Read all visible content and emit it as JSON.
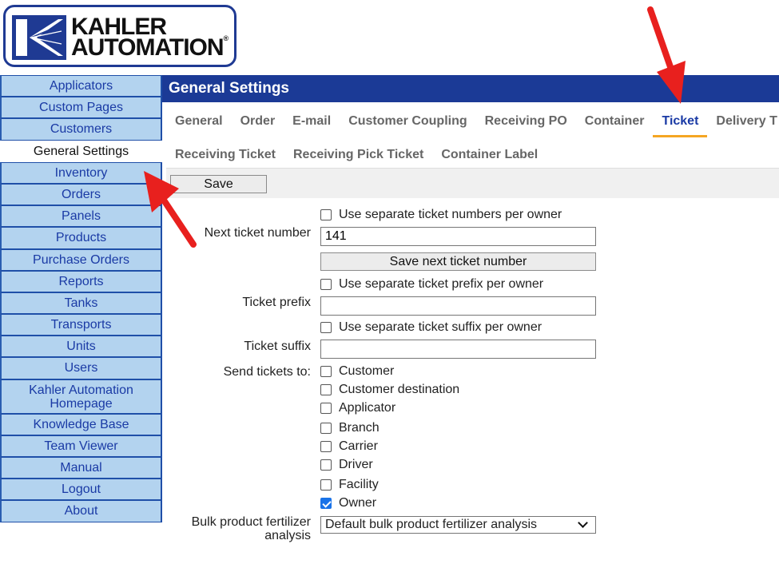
{
  "logo": {
    "line1": "KAHLER",
    "line2": "AUTOMATION",
    "reg": "®"
  },
  "sidebar": {
    "items": [
      {
        "label": "Applicators"
      },
      {
        "label": "Custom Pages"
      },
      {
        "label": "Customers"
      },
      {
        "label": "General Settings",
        "active": true
      },
      {
        "label": "Inventory"
      },
      {
        "label": "Orders"
      },
      {
        "label": "Panels"
      },
      {
        "label": "Products"
      },
      {
        "label": "Purchase Orders"
      },
      {
        "label": "Reports"
      },
      {
        "label": "Tanks"
      },
      {
        "label": "Transports"
      },
      {
        "label": "Units"
      },
      {
        "label": "Users"
      },
      {
        "label": "Kahler Automation Homepage"
      },
      {
        "label": "Knowledge Base"
      },
      {
        "label": "Team Viewer"
      },
      {
        "label": "Manual"
      },
      {
        "label": "Logout"
      },
      {
        "label": "About"
      }
    ]
  },
  "header": {
    "title": "General Settings"
  },
  "tabs": {
    "row1": [
      "General",
      "Order",
      "E-mail",
      "Customer Coupling",
      "Receiving PO",
      "Container",
      "Ticket",
      "Delivery T"
    ],
    "row2": [
      "Receiving Ticket",
      "Receiving Pick Ticket",
      "Container Label"
    ],
    "active": "Ticket"
  },
  "toolbar": {
    "save_label": "Save"
  },
  "form": {
    "sep_numbers_label": "Use separate ticket numbers per owner",
    "next_ticket_label": "Next ticket number",
    "next_ticket_value": "141",
    "save_next_label": "Save next ticket number",
    "sep_prefix_label": "Use separate ticket prefix per owner",
    "prefix_label": "Ticket prefix",
    "prefix_value": "",
    "sep_suffix_label": "Use separate ticket suffix per owner",
    "suffix_label": "Ticket suffix",
    "suffix_value": "",
    "send_to_label": "Send tickets to:",
    "recipients": [
      {
        "label": "Customer",
        "checked": false
      },
      {
        "label": "Customer destination",
        "checked": false
      },
      {
        "label": "Applicator",
        "checked": false
      },
      {
        "label": "Branch",
        "checked": false
      },
      {
        "label": "Carrier",
        "checked": false
      },
      {
        "label": "Driver",
        "checked": false
      },
      {
        "label": "Facility",
        "checked": false
      },
      {
        "label": "Owner",
        "checked": true
      }
    ],
    "bulk_label_line1": "Bulk product fertilizer",
    "bulk_label_line2": "analysis",
    "bulk_value": "Default bulk product fertilizer analysis"
  },
  "colors": {
    "header_bg": "#1b3a96",
    "nav_bg": "#b3d3ef",
    "tab_active_underline": "#f5a623",
    "arrow": "#e8201e"
  }
}
